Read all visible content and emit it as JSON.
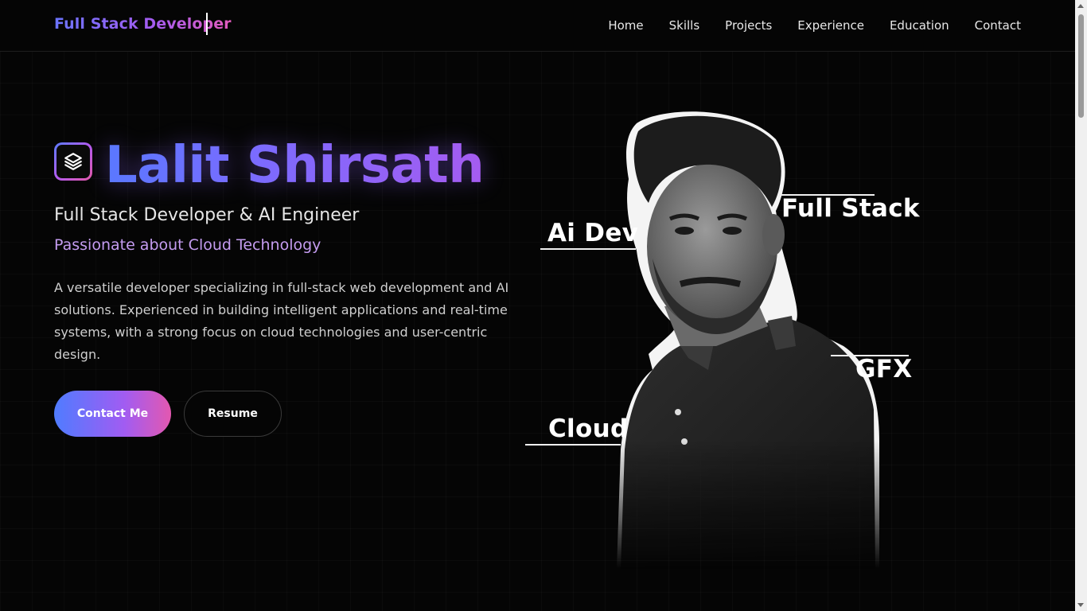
{
  "nav": {
    "brand": "Full Stack Developer",
    "links": [
      "Home",
      "Skills",
      "Projects",
      "Experience",
      "Education",
      "Contact"
    ]
  },
  "hero": {
    "logo_icon": "layers-icon",
    "name": "Lalit Shirsath",
    "role": "Full Stack Developer & AI Engineer",
    "tagline": "Passionate about Cloud Technology",
    "description": "A versatile developer specializing in full-stack web development and AI solutions. Experienced in building intelligent applications and real-time systems, with a strong focus on cloud technologies and user-centric design.",
    "contact_button": "Contact Me",
    "resume_button": "Resume"
  },
  "portrait_labels": {
    "ai_dev": "Ai Dev",
    "full_stack": "Full Stack",
    "gfx": "GFX",
    "cloud": "Cloud"
  },
  "colors": {
    "background": "#050505",
    "accent_blue": "#5a78ff",
    "accent_purple": "#a55cf0",
    "accent_pink": "#e358b0",
    "tagline": "#c49cf0"
  }
}
